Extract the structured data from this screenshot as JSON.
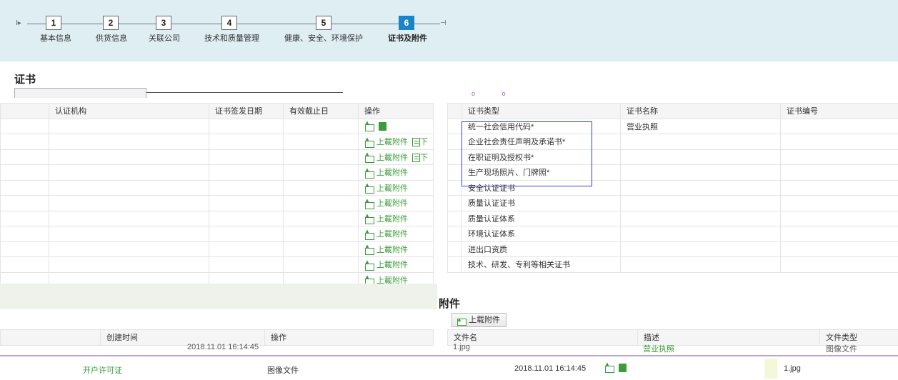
{
  "stepper": {
    "steps": [
      {
        "num": "1",
        "label": "基本信息"
      },
      {
        "num": "2",
        "label": "供货信息"
      },
      {
        "num": "3",
        "label": "关联公司"
      },
      {
        "num": "4",
        "label": "技术和质量管理"
      },
      {
        "num": "5",
        "label": "健康、安全、环境保护"
      },
      {
        "num": "6",
        "label": "证书及附件"
      }
    ],
    "start_glyph": "I▸",
    "end_glyph": "⊣"
  },
  "certificates": {
    "title": "证书",
    "left_table": {
      "headers": [
        "",
        "认证机构",
        "证书签发日期",
        "有效截止日",
        "操作"
      ],
      "upload_label": "上載附件",
      "partial_label": "下"
    },
    "right_table": {
      "headers": [
        "证书类型",
        "证书名称",
        "证书编号",
        ""
      ],
      "rows": [
        {
          "type": "统一社会信用代码*",
          "name": "营业执照"
        },
        {
          "type": "企业社会责任声明及承诺书*",
          "name": ""
        },
        {
          "type": "在职证明及授权书*",
          "name": ""
        },
        {
          "type": "生产现场照片、门牌照*",
          "name": ""
        },
        {
          "type": "安全认证证书",
          "name": ""
        },
        {
          "type": "质量认证证书",
          "name": ""
        },
        {
          "type": "质量认证体系",
          "name": ""
        },
        {
          "type": "环境认证体系",
          "name": ""
        },
        {
          "type": "进出口资质",
          "name": ""
        },
        {
          "type": "技术、研发、专利等相关证书",
          "name": ""
        }
      ]
    }
  },
  "attachments": {
    "title": "附件",
    "upload_button": "上载附件",
    "left_headers": {
      "created": "创建时间",
      "ops": "操作"
    },
    "right_headers": {
      "filename": "文件名",
      "desc": "描述",
      "filetype": "文件类型"
    },
    "partial_row": {
      "created": "2018.11.01 16:14:45",
      "filename": "1.jpg",
      "desc": "营业执照",
      "filetype": "图像文件"
    },
    "bottom_row": {
      "desc": "开户许可证",
      "filetype": "图像文件",
      "created": "2018.11.01 16:14:45",
      "filename": "1.jpg"
    }
  }
}
